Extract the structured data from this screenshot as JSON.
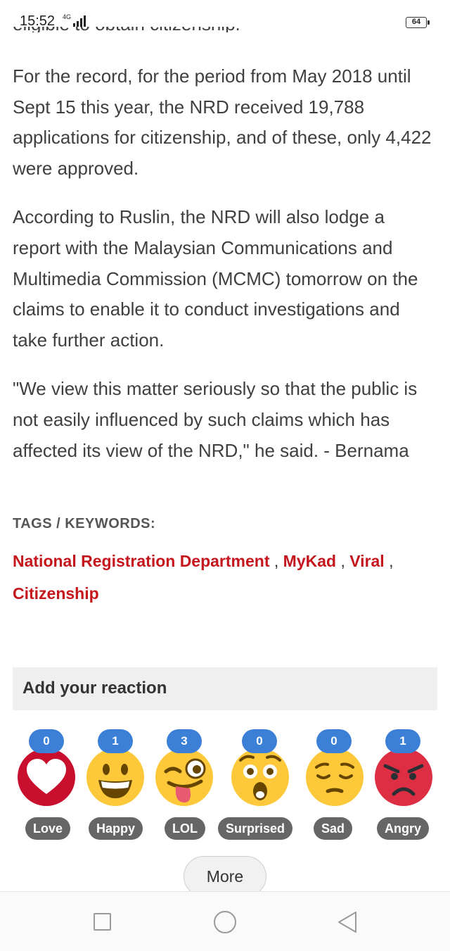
{
  "status_bar": {
    "time": "15:52",
    "network": "4G",
    "battery": "64"
  },
  "article": {
    "cut_line": "eligible to obtain citizenship.",
    "paragraphs": [
      "For the record, for the period from May 2018 until Sept 15 this year, the NRD received 19,788 applications for citizenship, and of these, only 4,422 were approved.",
      "According to Ruslin, the NRD will also lodge a report with the Malaysian Communications and Multimedia Commission (MCMC) tomorrow on the claims to enable it to conduct investigations and take further action.",
      "\"We view this matter seriously so that the public is not easily influenced by such claims which has affected its view of the NRD,\" he said. - Bernama"
    ]
  },
  "tags": {
    "title": "TAGS / KEYWORDS:",
    "items": [
      "National Registration Department",
      "MyKad",
      "Viral",
      "Citizenship"
    ],
    "separator": ","
  },
  "reactions": {
    "header": "Add your reaction",
    "items": [
      {
        "label": "Love",
        "count": "0",
        "icon": "heart-icon"
      },
      {
        "label": "Happy",
        "count": "1",
        "icon": "happy-face-icon"
      },
      {
        "label": "LOL",
        "count": "3",
        "icon": "lol-face-icon"
      },
      {
        "label": "Surprised",
        "count": "0",
        "icon": "surprised-face-icon"
      },
      {
        "label": "Sad",
        "count": "0",
        "icon": "sad-face-icon"
      },
      {
        "label": "Angry",
        "count": "1",
        "icon": "angry-face-icon"
      }
    ],
    "more_label": "More"
  },
  "colors": {
    "tag_link": "#c4161c",
    "badge": "#3b7fd6",
    "label_pill": "#666666",
    "love_circle": "#c8102e",
    "emoji_yellow": "#fdc93b",
    "angry_red": "#dd2e44"
  }
}
